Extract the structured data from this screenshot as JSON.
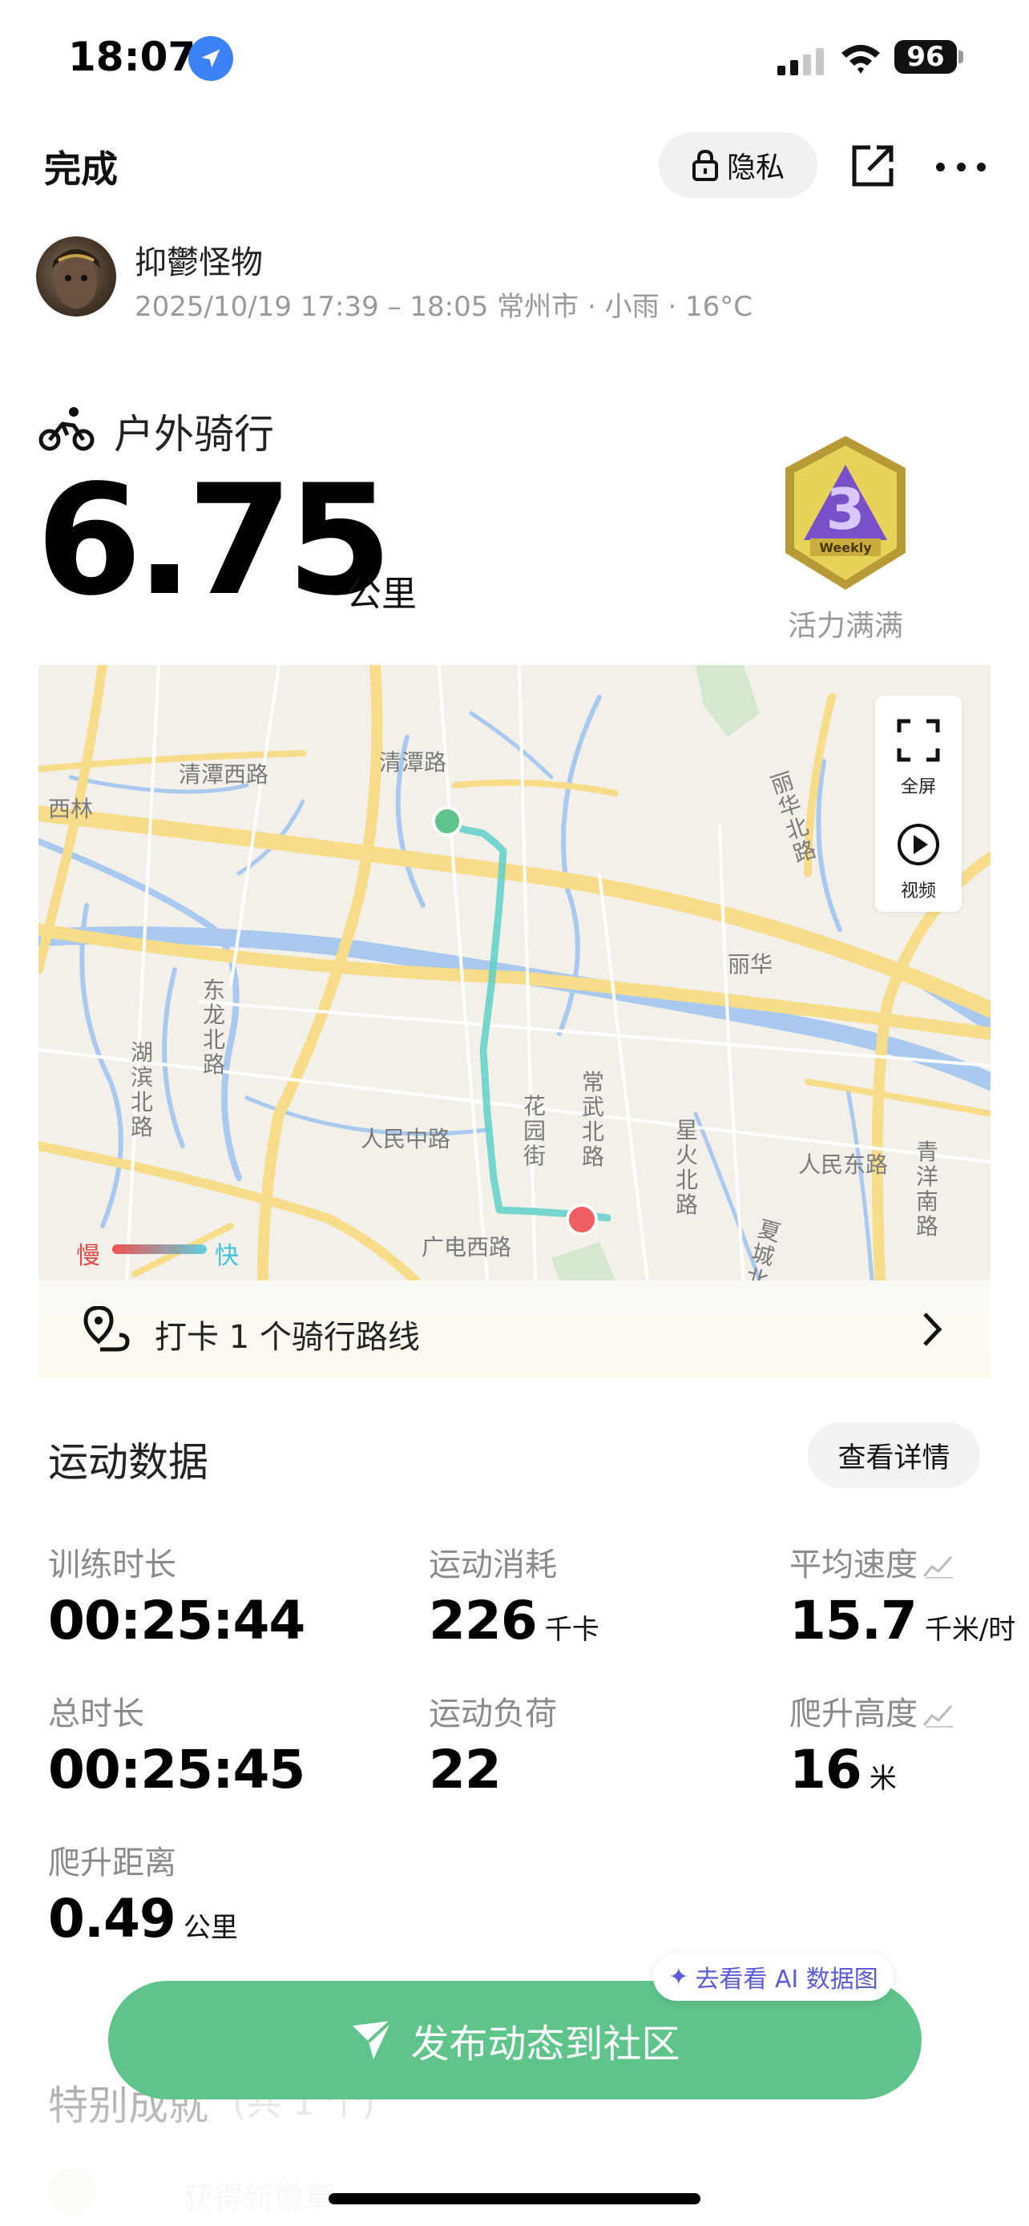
{
  "status_bar": {
    "time": "18:07",
    "battery": "96",
    "location_icon": "location-arrow-icon",
    "signal_icon": "cellular-signal-icon",
    "wifi_icon": "wifi-icon"
  },
  "header": {
    "done_label": "完成",
    "privacy_label": "隐私",
    "share_icon": "share-icon",
    "more_icon": "more-icon"
  },
  "user": {
    "name": "抑鬱怪物",
    "meta": "2025/10/19 17:39 – 18:05 常州市 · 小雨 · 16°C"
  },
  "activity": {
    "type": "户外骑行",
    "distance": "6.75",
    "distance_unit": "公里",
    "badge_label": "活力满满",
    "badge_text": "Weekly",
    "badge_number": "3"
  },
  "map": {
    "labels": [
      "清潭西路",
      "清潭路",
      "西林",
      "丽华北路",
      "丽华",
      "东龙北路",
      "湖滨北路",
      "人民中路",
      "花园街",
      "常武北路",
      "星火北路",
      "人民东路",
      "青洋南路",
      "广电西路",
      "夏城北"
    ],
    "fullscreen_label": "全屏",
    "video_label": "视频",
    "legend_slow": "慢",
    "legend_fast": "快",
    "colors": {
      "start": "#5fc48a",
      "end": "#ef5f62",
      "route": "#5fd0c8",
      "road": "#f7dc8a",
      "water": "#a9c9ee"
    }
  },
  "checkin": {
    "text": "打卡 1 个骑行路线"
  },
  "stats": {
    "title": "运动数据",
    "details_label": "查看详情",
    "items": [
      {
        "label": "训练时长",
        "value": "00:25:44",
        "unit": ""
      },
      {
        "label": "运动消耗",
        "value": "226",
        "unit": "千卡"
      },
      {
        "label": "平均速度",
        "value": "15.7",
        "unit": "千米/时"
      },
      {
        "label": "总时长",
        "value": "00:25:45",
        "unit": ""
      },
      {
        "label": "运动负荷",
        "value": "22",
        "unit": ""
      },
      {
        "label": "爬升高度",
        "value": "16",
        "unit": "米"
      },
      {
        "label": "爬升距离",
        "value": "0.49",
        "unit": "公里"
      }
    ]
  },
  "ai_tag": "去看看 AI 数据图",
  "publish_label": "发布动态到社区",
  "achievements": {
    "title": "特别成就",
    "count": "(共 1 个)",
    "item": "获得新徽章"
  }
}
